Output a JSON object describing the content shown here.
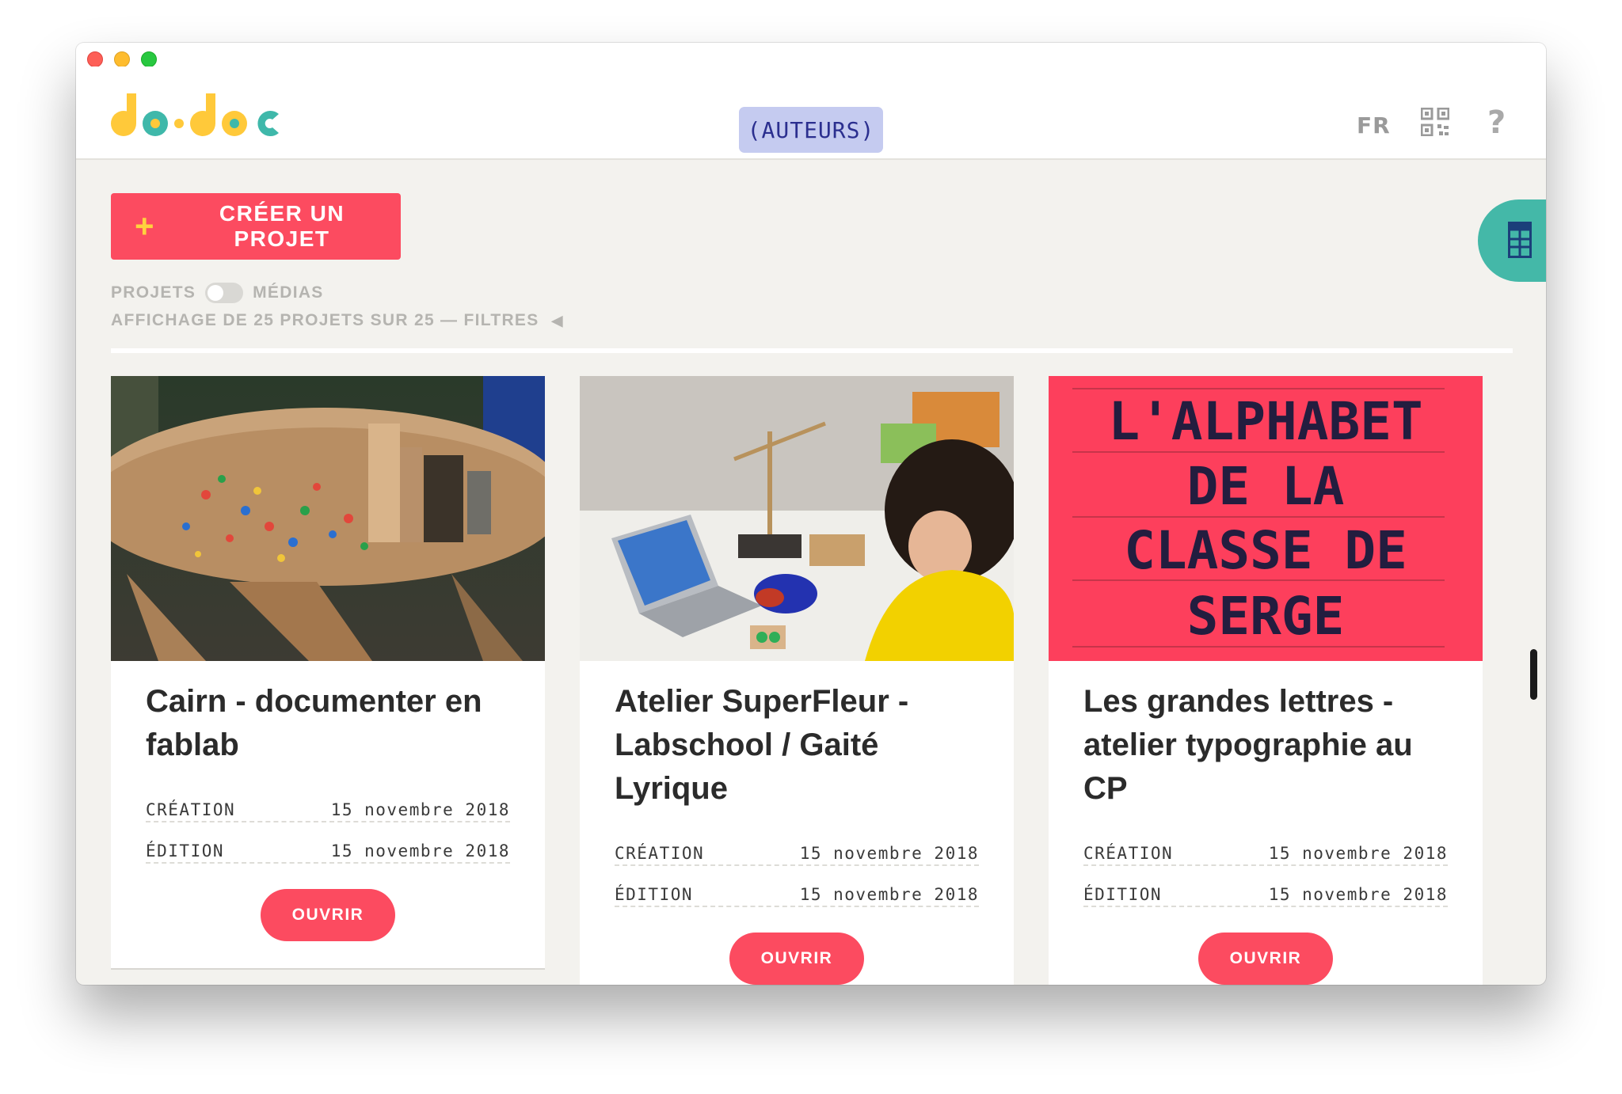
{
  "header": {
    "authors_label": "(AUTEURS)",
    "lang_label": "FR",
    "help_label": "?"
  },
  "toolbar": {
    "create_plus": "+",
    "create_label": "CRÉER UN PROJET"
  },
  "view_toggle": {
    "left_label": "PROJETS",
    "right_label": "MÉDIAS"
  },
  "summary": {
    "count_text": "AFFICHAGE DE 25 PROJETS SUR 25 — FILTRES",
    "arrow": "◀"
  },
  "cards": [
    {
      "title": "Cairn - documenter en fablab",
      "creation_label": "CRÉATION",
      "creation_date": "15 novembre 2018",
      "edition_label": "ÉDITION",
      "edition_date": "15 novembre 2018",
      "open_label": "OUVRIR"
    },
    {
      "title": "Atelier SuperFleur - Labschool / Gaité Lyrique",
      "creation_label": "CRÉATION",
      "creation_date": "15 novembre 2018",
      "edition_label": "ÉDITION",
      "edition_date": "15 novembre 2018",
      "open_label": "OUVRIR"
    },
    {
      "title": "Les grandes lettres - atelier typographie au CP",
      "creation_label": "CRÉATION",
      "creation_date": "15 novembre 2018",
      "edition_label": "ÉDITION",
      "edition_date": "15 novembre 2018",
      "open_label": "OUVRIR",
      "poster_lines": [
        "L'ALPHABET",
        "DE LA",
        "CLASSE DE",
        "SERGE"
      ]
    }
  ],
  "colors": {
    "accent": "#fc4b60",
    "teal": "#44b8a8",
    "logo_yellow": "#ffc93a",
    "logo_teal": "#3fb8aa",
    "authors_bg": "#c5cbf0",
    "background": "#f3f2ee"
  },
  "icons": [
    "qr-code-icon",
    "help-icon",
    "plus-icon",
    "layout-panel-icon",
    "triangle-left-icon"
  ]
}
